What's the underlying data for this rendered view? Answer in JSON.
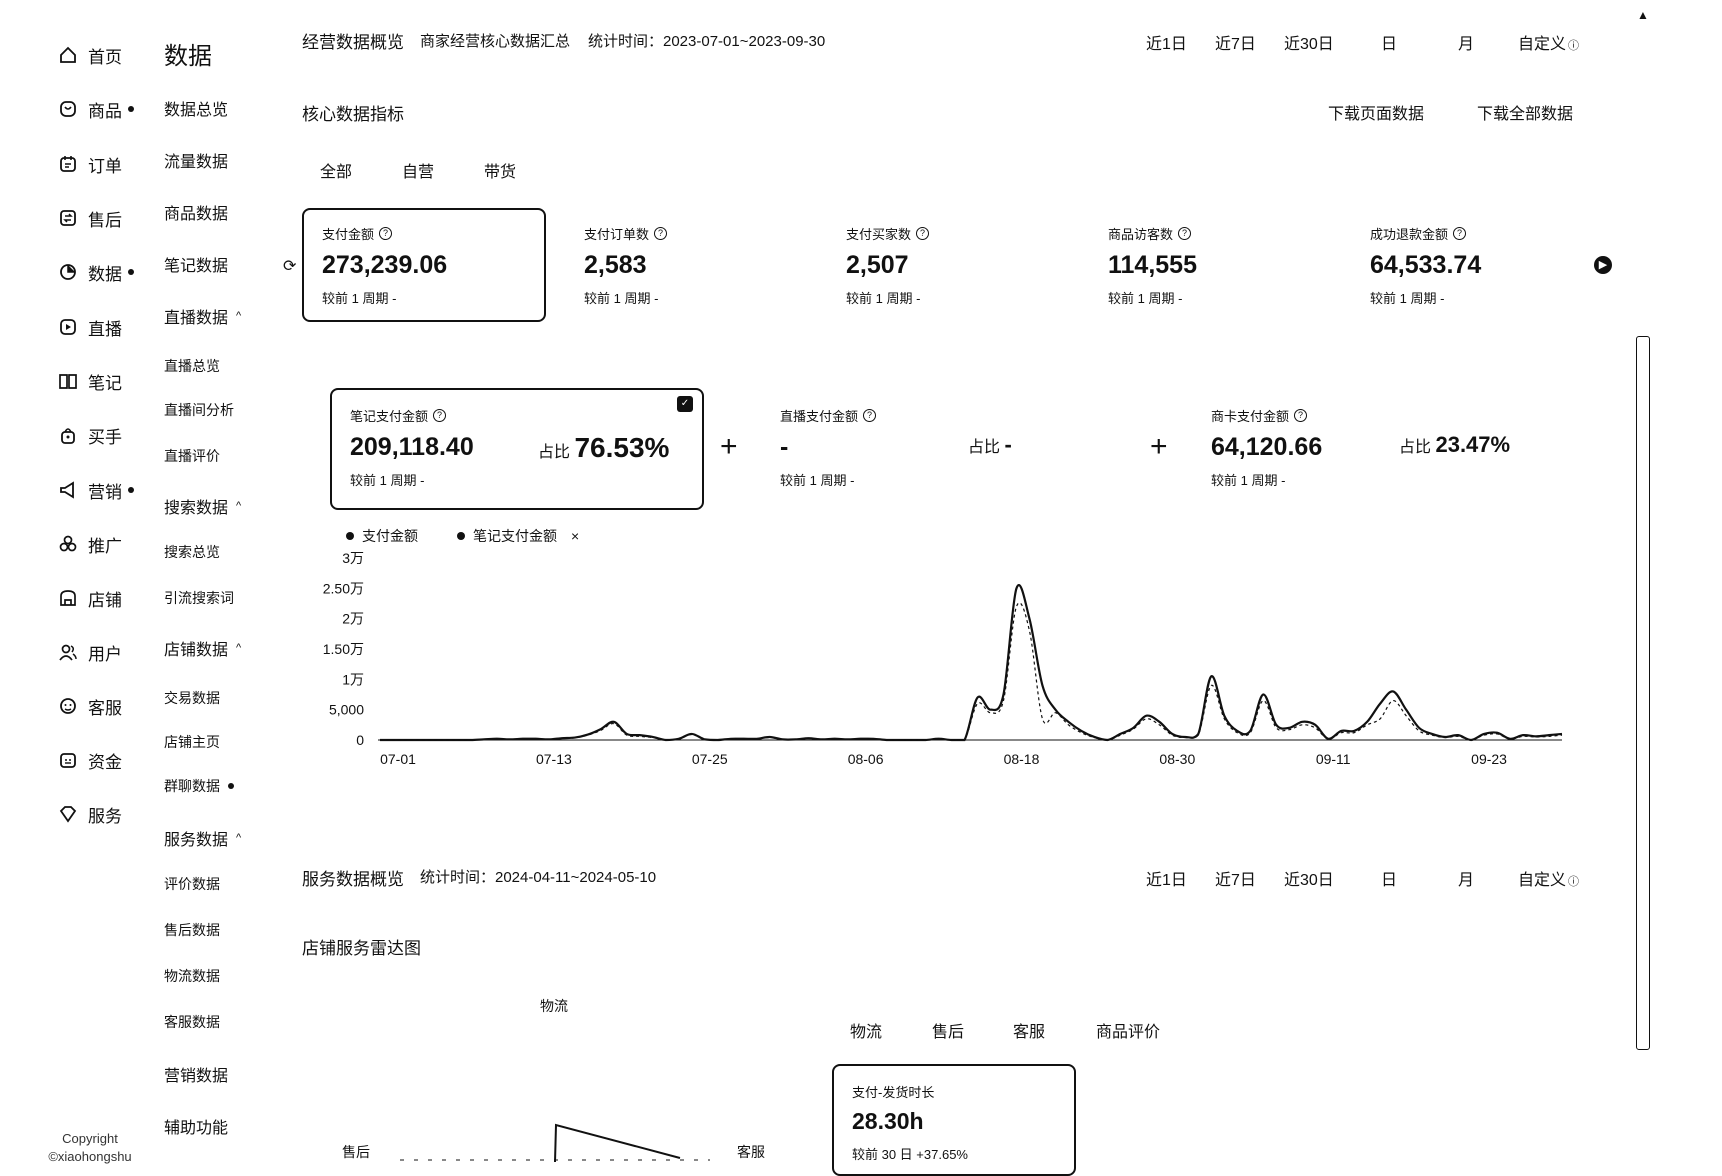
{
  "nav": [
    {
      "label": "首页",
      "icon": "home-icon",
      "dot": false
    },
    {
      "label": "商品",
      "icon": "product-icon",
      "dot": true
    },
    {
      "label": "订单",
      "icon": "order-icon",
      "dot": false
    },
    {
      "label": "售后",
      "icon": "after-sale-icon",
      "dot": false
    },
    {
      "label": "数据",
      "icon": "data-icon",
      "dot": true
    },
    {
      "label": "直播",
      "icon": "live-icon",
      "dot": false
    },
    {
      "label": "笔记",
      "icon": "notebook-icon",
      "dot": false
    },
    {
      "label": "买手",
      "icon": "buyer-icon",
      "dot": false
    },
    {
      "label": "营销",
      "icon": "megaphone-icon",
      "dot": true
    },
    {
      "label": "推广",
      "icon": "promotion-icon",
      "dot": false
    },
    {
      "label": "店铺",
      "icon": "store-icon",
      "dot": false
    },
    {
      "label": "用户",
      "icon": "users-icon",
      "dot": false
    },
    {
      "label": "客服",
      "icon": "customer-service-icon",
      "dot": false
    },
    {
      "label": "资金",
      "icon": "wallet-icon",
      "dot": false
    },
    {
      "label": "服务",
      "icon": "service-icon",
      "dot": false
    }
  ],
  "copyright": {
    "line1": "Copyright",
    "line2": "©xiaohongshu"
  },
  "subnav": {
    "title": "数据",
    "items": [
      {
        "label": "数据总览",
        "small": false,
        "chev": false,
        "dot": false
      },
      {
        "label": "流量数据",
        "small": false,
        "chev": false,
        "dot": false
      },
      {
        "label": "商品数据",
        "small": false,
        "chev": false,
        "dot": false
      },
      {
        "label": "笔记数据",
        "small": false,
        "chev": false,
        "dot": false
      },
      {
        "label": "直播数据",
        "small": false,
        "chev": true,
        "dot": false
      },
      {
        "label": "直播总览",
        "small": true,
        "chev": false,
        "dot": false
      },
      {
        "label": "直播间分析",
        "small": true,
        "chev": false,
        "dot": false
      },
      {
        "label": "直播评价",
        "small": true,
        "chev": false,
        "dot": false
      },
      {
        "label": "搜索数据",
        "small": false,
        "chev": true,
        "dot": false
      },
      {
        "label": "搜索总览",
        "small": true,
        "chev": false,
        "dot": false
      },
      {
        "label": "引流搜索词",
        "small": true,
        "chev": false,
        "dot": false
      },
      {
        "label": "店铺数据",
        "small": false,
        "chev": true,
        "dot": false
      },
      {
        "label": "交易数据",
        "small": true,
        "chev": false,
        "dot": false
      },
      {
        "label": "店铺主页",
        "small": true,
        "chev": false,
        "dot": false
      },
      {
        "label": "群聊数据",
        "small": true,
        "chev": false,
        "dot": true
      },
      {
        "label": "服务数据",
        "small": false,
        "chev": true,
        "dot": false
      },
      {
        "label": "评价数据",
        "small": true,
        "chev": false,
        "dot": false
      },
      {
        "label": "售后数据",
        "small": true,
        "chev": false,
        "dot": false
      },
      {
        "label": "物流数据",
        "small": true,
        "chev": false,
        "dot": false
      },
      {
        "label": "客服数据",
        "small": true,
        "chev": false,
        "dot": false
      },
      {
        "label": "营销数据",
        "small": false,
        "chev": false,
        "dot": false
      },
      {
        "label": "辅助功能",
        "small": false,
        "chev": false,
        "dot": false
      }
    ]
  },
  "overview": {
    "title": "经营数据概览",
    "subtitle": "商家经营核心数据汇总",
    "time_label": "统计时间：2023-07-01~2023-09-30",
    "periods": [
      "近1日",
      "近7日",
      "近30日",
      "日",
      "月",
      "自定义"
    ]
  },
  "core": {
    "title": "核心数据指标",
    "download_page": "下载页面数据",
    "download_all": "下载全部数据",
    "tabs": [
      "全部",
      "自营",
      "带货"
    ]
  },
  "metrics": [
    {
      "label": "支付金额",
      "value": "273,239.06",
      "compare": "较前 1 周期  -"
    },
    {
      "label": "支付订单数",
      "value": "2,583",
      "compare": "较前 1 周期  -"
    },
    {
      "label": "支付买家数",
      "value": "2,507",
      "compare": "较前 1 周期  -"
    },
    {
      "label": "商品访客数",
      "value": "114,555",
      "compare": "较前 1 周期  -"
    },
    {
      "label": "成功退款金额",
      "value": "64,533.74",
      "compare": "较前 1 周期  -"
    }
  ],
  "breakdown": [
    {
      "label": "笔记支付金额",
      "value": "209,118.40",
      "compare": "较前 1 周期  -",
      "ratio_label": "占比",
      "ratio": "76.53%"
    },
    {
      "label": "直播支付金额",
      "value": "-",
      "compare": "较前 1 周期  -",
      "ratio_label": "占比",
      "ratio": "-"
    },
    {
      "label": "商卡支付金额",
      "value": "64,120.66",
      "compare": "较前 1 周期  -",
      "ratio_label": "占比",
      "ratio": "23.47%"
    }
  ],
  "plus": "+",
  "legend": [
    {
      "label": "支付金额"
    },
    {
      "label": "笔记支付金额"
    }
  ],
  "legend_close": "×",
  "chart_data": {
    "type": "line",
    "x": [
      "07-01",
      "07-02",
      "07-03",
      "07-04",
      "07-05",
      "07-06",
      "07-07",
      "07-08",
      "07-09",
      "07-10",
      "07-11",
      "07-12",
      "07-13",
      "07-14",
      "07-15",
      "07-16",
      "07-17",
      "07-18",
      "07-19",
      "07-20",
      "07-21",
      "07-22",
      "07-23",
      "07-24",
      "07-25",
      "07-26",
      "07-27",
      "07-28",
      "07-29",
      "07-30",
      "07-31",
      "08-01",
      "08-02",
      "08-03",
      "08-04",
      "08-05",
      "08-06",
      "08-07",
      "08-08",
      "08-09",
      "08-10",
      "08-11",
      "08-12",
      "08-13",
      "08-14",
      "08-15",
      "08-16",
      "08-17",
      "08-18",
      "08-19",
      "08-20",
      "08-21",
      "08-22",
      "08-23",
      "08-24",
      "08-25",
      "08-26",
      "08-27",
      "08-28",
      "08-29",
      "08-30",
      "08-31",
      "09-01",
      "09-02",
      "09-03",
      "09-04",
      "09-05",
      "09-06",
      "09-07",
      "09-08",
      "09-09",
      "09-10",
      "09-11",
      "09-12",
      "09-13",
      "09-14",
      "09-15",
      "09-16",
      "09-17",
      "09-18",
      "09-19",
      "09-20",
      "09-21",
      "09-22",
      "09-23",
      "09-24",
      "09-25",
      "09-26",
      "09-27",
      "09-28",
      "09-29",
      "09-30"
    ],
    "series": [
      {
        "name": "支付金额",
        "values": [
          0,
          0,
          0,
          0,
          0,
          0,
          0,
          0,
          100,
          200,
          100,
          200,
          200,
          100,
          300,
          400,
          900,
          1800,
          3000,
          1000,
          800,
          500,
          0,
          200,
          1000,
          100,
          0,
          200,
          200,
          200,
          500,
          100,
          100,
          300,
          100,
          200,
          100,
          200,
          200,
          0,
          0,
          0,
          0,
          200,
          0,
          0,
          7000,
          5000,
          7500,
          25000,
          20000,
          9000,
          5000,
          3000,
          1500,
          500,
          0,
          1000,
          2000,
          4000,
          3000,
          1000,
          500,
          1000,
          10500,
          4000,
          1500,
          1500,
          7500,
          2500,
          2000,
          3000,
          2500,
          200,
          1500,
          1500,
          3000,
          6000,
          8000,
          5000,
          2000,
          1000,
          500,
          800,
          0,
          1000,
          1200,
          200,
          800,
          600,
          800,
          1000
        ]
      },
      {
        "name": "笔记支付金额",
        "values": [
          0,
          0,
          0,
          0,
          0,
          0,
          0,
          0,
          100,
          150,
          80,
          150,
          150,
          80,
          250,
          350,
          800,
          1600,
          2700,
          800,
          600,
          400,
          0,
          150,
          900,
          80,
          0,
          150,
          150,
          150,
          400,
          80,
          80,
          250,
          80,
          150,
          80,
          150,
          150,
          0,
          0,
          0,
          0,
          150,
          0,
          0,
          6000,
          4500,
          6500,
          22000,
          18000,
          3500,
          4500,
          2500,
          1200,
          400,
          0,
          800,
          1800,
          3500,
          2500,
          800,
          400,
          800,
          9000,
          3500,
          1200,
          1200,
          6500,
          2000,
          1700,
          2500,
          2000,
          150,
          1200,
          1200,
          2500,
          3500,
          6500,
          4000,
          1500,
          800,
          400,
          600,
          0,
          800,
          1000,
          150,
          600,
          500,
          600,
          800
        ]
      }
    ],
    "x_tick_labels": [
      "07-01",
      "07-13",
      "07-25",
      "08-06",
      "08-18",
      "08-30",
      "09-11",
      "09-23"
    ],
    "y_tick_labels": [
      "0",
      "5,000",
      "1万",
      "1.50万",
      "2万",
      "2.50万",
      "3万"
    ],
    "ylim": [
      0,
      30000
    ]
  },
  "service": {
    "title": "服务数据概览",
    "time_label": "统计时间：2024-04-11~2024-05-10",
    "periods": [
      "近1日",
      "近7日",
      "近30日",
      "日",
      "月",
      "自定义"
    ],
    "radar_title": "店铺服务雷达图",
    "radar_axes": [
      "物流",
      "售后",
      "客服"
    ],
    "tabs": [
      "物流",
      "售后",
      "客服",
      "商品评价"
    ],
    "card": {
      "label": "支付-发货时长",
      "value": "28.30h",
      "compare": "较前 30 日 +37.65%"
    }
  }
}
